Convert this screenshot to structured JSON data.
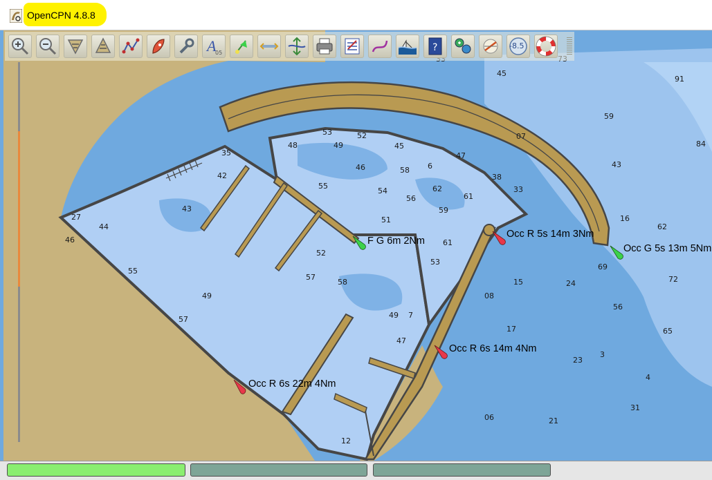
{
  "window": {
    "title": "OpenCPN 4.8.8"
  },
  "toolbar": {
    "buttons": [
      {
        "id": "zoom-in",
        "icon": "zoom-in-icon"
      },
      {
        "id": "zoom-out",
        "icon": "zoom-out-icon"
      },
      {
        "id": "scale-in",
        "icon": "chart-scale-down-icon"
      },
      {
        "id": "scale-out",
        "icon": "chart-scale-up-icon"
      },
      {
        "id": "route",
        "icon": "route-icon"
      },
      {
        "id": "auto-follow",
        "icon": "ship-icon"
      },
      {
        "id": "settings",
        "icon": "wrench-icon"
      },
      {
        "id": "text",
        "icon": "text-icon"
      },
      {
        "id": "current",
        "icon": "current-icon"
      },
      {
        "id": "tide",
        "icon": "tide-icon"
      },
      {
        "id": "depth",
        "icon": "depth-icon"
      },
      {
        "id": "print",
        "icon": "printer-icon"
      },
      {
        "id": "route-manager",
        "icon": "route-manager-icon"
      },
      {
        "id": "track",
        "icon": "track-icon"
      },
      {
        "id": "chart-quilt",
        "icon": "ship-chart-icon"
      },
      {
        "id": "help",
        "icon": "help-book-icon"
      },
      {
        "id": "ais",
        "icon": "ais-icon"
      },
      {
        "id": "ruler",
        "icon": "ruler-icon"
      },
      {
        "id": "depth-unit",
        "icon": "depth-unit-icon",
        "label": "-8.5"
      },
      {
        "id": "mob",
        "icon": "lifebuoy-icon"
      }
    ]
  },
  "chart": {
    "colors": {
      "land": "#c8b37d",
      "deep": "#6fa9df",
      "mid": "#9dc4ee",
      "shoal": "#6fa9df",
      "harbour_water": "#b0cff4",
      "breakwater": "#b99a52",
      "coast": "#464646"
    },
    "lights": [
      {
        "id": "fg",
        "text": "F G 6m 2Nm",
        "color": "#3cd24a"
      },
      {
        "id": "occr5",
        "text": "Occ R 5s 14m 3Nm",
        "color": "#e8384a"
      },
      {
        "id": "occg",
        "text": "Occ G 5s 13m 5Nm",
        "color": "#3cd24a"
      },
      {
        "id": "occr6",
        "text": "Occ R 6s 14m 4Nm",
        "color": "#e8384a"
      },
      {
        "id": "occr6b",
        "text": "Occ R 6s 22m 4Nm",
        "color": "#e8384a"
      }
    ],
    "soundings": [
      {
        "v": "45"
      },
      {
        "v": "91"
      },
      {
        "v": "59"
      },
      {
        "v": "84"
      },
      {
        "v": "43"
      },
      {
        "v": "07"
      },
      {
        "v": "16"
      },
      {
        "v": "62"
      },
      {
        "v": "69"
      },
      {
        "v": "72"
      },
      {
        "v": "56"
      },
      {
        "v": "65"
      },
      {
        "v": "24"
      },
      {
        "v": "15"
      },
      {
        "v": "08"
      },
      {
        "v": "17"
      },
      {
        "v": "23"
      },
      {
        "v": "3"
      },
      {
        "v": "4"
      },
      {
        "v": "31"
      },
      {
        "v": "06"
      },
      {
        "v": "21"
      },
      {
        "v": "53"
      },
      {
        "v": "52"
      },
      {
        "v": "48"
      },
      {
        "v": "49"
      },
      {
        "v": "45"
      },
      {
        "v": "47"
      },
      {
        "v": "58"
      },
      {
        "v": "6"
      },
      {
        "v": "38"
      },
      {
        "v": "33"
      },
      {
        "v": "46"
      },
      {
        "v": "55"
      },
      {
        "v": "54"
      },
      {
        "v": "61"
      },
      {
        "v": "62"
      },
      {
        "v": "59"
      },
      {
        "v": "56"
      },
      {
        "v": "51"
      },
      {
        "v": "52"
      },
      {
        "v": "61"
      },
      {
        "v": "53"
      },
      {
        "v": "57"
      },
      {
        "v": "58"
      },
      {
        "v": "49"
      },
      {
        "v": "7"
      },
      {
        "v": "47"
      },
      {
        "v": "42"
      },
      {
        "v": "43"
      },
      {
        "v": "44"
      },
      {
        "v": "27"
      },
      {
        "v": "46"
      },
      {
        "v": "55"
      },
      {
        "v": "57"
      },
      {
        "v": "49"
      },
      {
        "v": "35"
      },
      {
        "v": "12"
      },
      {
        "v": "33"
      },
      {
        "v": "73"
      }
    ]
  },
  "statusbar": {
    "panes": [
      {
        "label": ""
      },
      {
        "label": ""
      },
      {
        "label": ""
      }
    ]
  }
}
